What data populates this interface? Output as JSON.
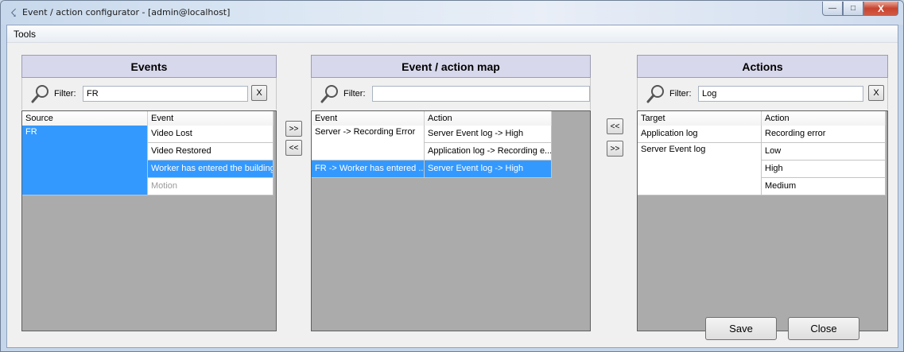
{
  "window": {
    "title": "Event / action configurator - [admin@localhost]",
    "app_icon": "lightning-icon",
    "min_glyph": "—",
    "max_glyph": "□",
    "close_glyph": "X"
  },
  "menu": {
    "tools": "Tools"
  },
  "events_panel": {
    "title": "Events",
    "filter_label": "Filter:",
    "filter_value": "FR",
    "clear_label": "X",
    "columns": [
      "Source",
      "Event"
    ],
    "source": "FR",
    "rows": [
      {
        "event": "Video Lost",
        "selected": false,
        "dim": false
      },
      {
        "event": "Video Restored",
        "selected": false,
        "dim": false
      },
      {
        "event": "Worker has entered the building",
        "selected": true,
        "dim": false
      },
      {
        "event": "Motion",
        "selected": false,
        "dim": true
      }
    ]
  },
  "map_panel": {
    "title": "Event / action map",
    "filter_label": "Filter:",
    "filter_value": "",
    "columns": [
      "Event",
      "Action"
    ],
    "groups": [
      {
        "event": "Server -> Recording Error",
        "actions": [
          "Server Event log -> High",
          "Application log -> Recording e..."
        ],
        "selected": false
      },
      {
        "event": "FR -> Worker has entered ...",
        "actions": [
          "Server Event log -> High"
        ],
        "selected": true
      }
    ]
  },
  "actions_panel": {
    "title": "Actions",
    "filter_label": "Filter:",
    "filter_value": "Log",
    "clear_label": "X",
    "columns": [
      "Target",
      "Action"
    ],
    "groups": [
      {
        "target": "Application log",
        "actions": [
          "Recording error"
        ]
      },
      {
        "target": "Server Event log",
        "actions": [
          "Low",
          "High",
          "Medium"
        ]
      }
    ]
  },
  "buttons": {
    "add_event": ">>",
    "remove_event": "<<",
    "remove_action": "<<",
    "add_action": ">>",
    "save": "Save",
    "close": "Close"
  }
}
